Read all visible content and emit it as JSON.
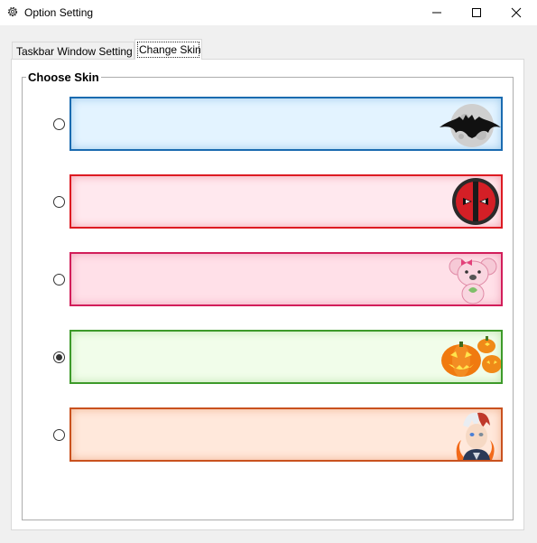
{
  "window": {
    "title": "Option Setting",
    "icon": "gear-icon"
  },
  "tabs": [
    {
      "label": "Taskbar Window Setting",
      "selected": false
    },
    {
      "label": "Change Skin",
      "selected": true
    }
  ],
  "group": {
    "title": "Choose Skin"
  },
  "skins": [
    {
      "id": "batman",
      "icon": "batman-moon-icon",
      "selected": false,
      "color": "#1a6bb0"
    },
    {
      "id": "deadpool",
      "icon": "deadpool-icon",
      "selected": false,
      "color": "#dd1a22"
    },
    {
      "id": "koala",
      "icon": "pink-koala-icon",
      "selected": false,
      "color": "#d21e5a"
    },
    {
      "id": "halloween",
      "icon": "pumpkin-icon",
      "selected": true,
      "color": "#3d9a2a"
    },
    {
      "id": "anime",
      "icon": "anime-hero-icon",
      "selected": false,
      "color": "#c9511e"
    }
  ]
}
